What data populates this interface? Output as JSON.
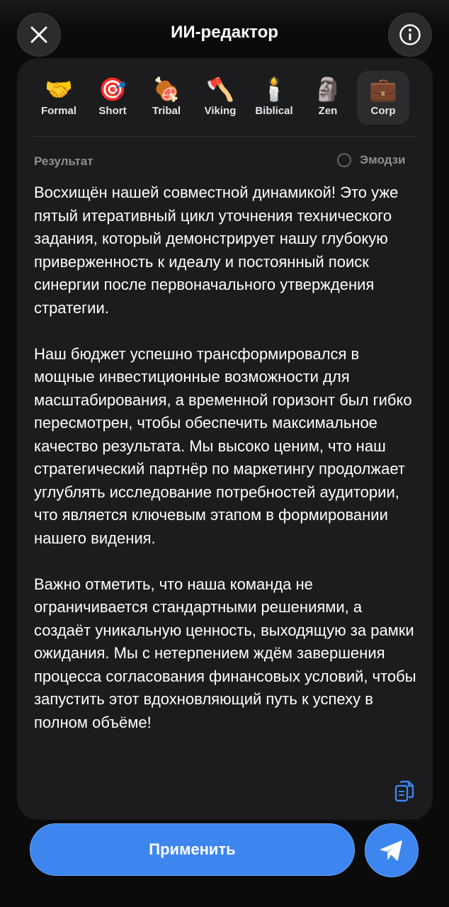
{
  "header": {
    "title": "ИИ-редактор"
  },
  "styles": [
    {
      "emoji": "🤝",
      "label": "Formal"
    },
    {
      "emoji": "🎯",
      "label": "Short"
    },
    {
      "emoji": "🍖",
      "label": "Tribal"
    },
    {
      "emoji": "🪓",
      "label": "Viking"
    },
    {
      "emoji": "🕯️",
      "label": "Biblical"
    },
    {
      "emoji": "🗿",
      "label": "Zen"
    },
    {
      "emoji": "💼",
      "label": "Corp"
    }
  ],
  "selected_style": "Corp",
  "result": {
    "label": "Результат",
    "emoji_toggle_label": "Эмодзи",
    "paragraphs": [
      "Восхищён нашей совместной динамикой! Это уже пятый итеративный цикл уточнения технического задания, который демонстрирует нашу глубокую приверженность к идеалу и постоянный поиск синергии после первоначального утверждения стратегии.",
      "Наш бюджет успешно трансформировался в мощные инвестиционные возможности для масштабирования, а временной горизонт был гибко пересмотрен, чтобы обеспечить максимальное качество результата. Мы высоко ценим, что наш стратегический партнёр по маркетингу продолжает углублять исследование потребностей аудитории, что является ключевым этапом в формировании нашего видения.",
      "Важно отметить, что наша команда не ограничивается стандартными решениями, а создаёт уникальную ценность, выходящую за рамки ожидания. Мы с нетерпением ждём завершения процесса согласования финансовых условий, чтобы запустить этот вдохновляющий путь к успеху в полном объёме!"
    ]
  },
  "actions": {
    "apply_label": "Применить"
  },
  "colors": {
    "accent": "#3d86f0",
    "panel": "#1c1c1e",
    "background": "#0b0b0c"
  }
}
